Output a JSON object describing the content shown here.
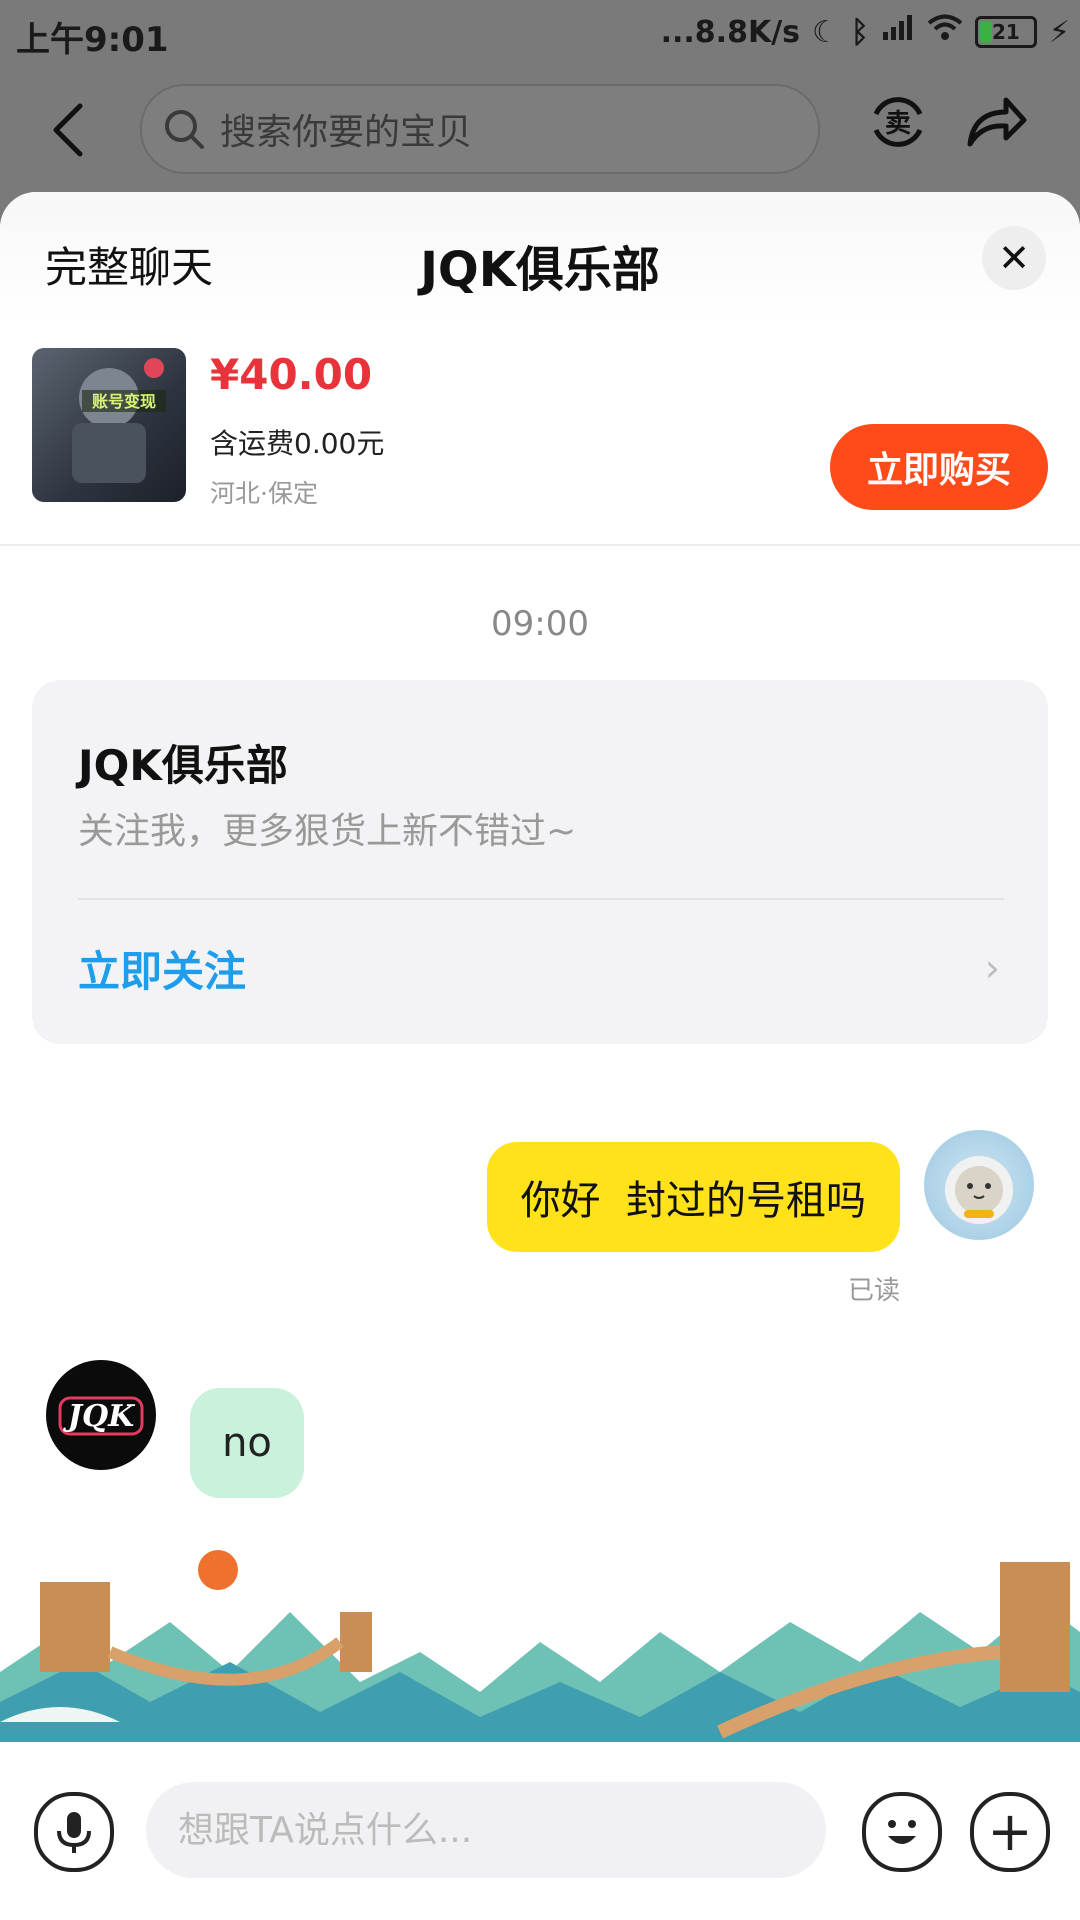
{
  "status_bar": {
    "time": "上午9:01",
    "network_speed": "...8.8K/s",
    "battery": "21"
  },
  "header": {
    "search_placeholder": "搜索你要的宝贝"
  },
  "sheet": {
    "full_chat_label": "完整聊天",
    "title": "JQK俱乐部"
  },
  "product": {
    "price": "¥40.00",
    "shipping": "含运费0.00元",
    "location": "河北·保定",
    "buy_label": "立即购买",
    "image_text": "账号变现"
  },
  "chat": {
    "timestamp": "09:00",
    "follow_card": {
      "shop_name": "JQK俱乐部",
      "description": "关注我，更多狠货上新不错过~",
      "follow_label": "立即关注"
    },
    "messages": [
      {
        "from": "me",
        "text": "你好  封过的号租吗",
        "status": "已读"
      },
      {
        "from": "shop",
        "text": "no"
      }
    ],
    "shop_avatar_text": "JQK"
  },
  "input": {
    "placeholder": "想跟TA说点什么..."
  },
  "colors": {
    "price": "#e8333a",
    "buy_button": "#ff4a1a",
    "follow_link": "#1e9eea",
    "my_bubble": "#ffe219",
    "their_bubble": "#c9f1dc"
  }
}
